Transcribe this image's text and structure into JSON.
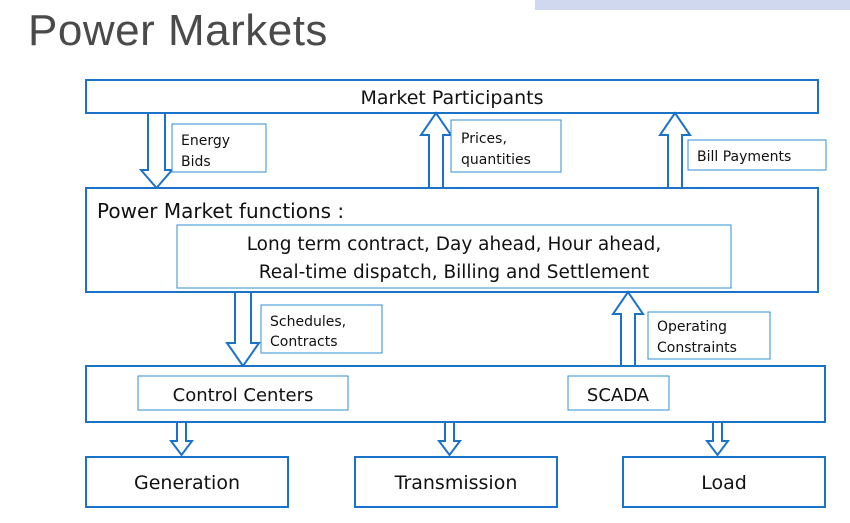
{
  "title": "Power Markets",
  "market_participants": "Market Participants",
  "labels": {
    "energy_bids": [
      "Energy",
      "Bids"
    ],
    "prices_quantities": [
      "Prices,",
      "quantities"
    ],
    "bill_payments": "Bill Payments",
    "schedules_contracts": [
      "Schedules,",
      "Contracts"
    ],
    "operating_constraints": [
      "Operating",
      "Constraints"
    ]
  },
  "functions": {
    "heading": "Power Market functions :",
    "line1": "Long term contract, Day ahead, Hour ahead,",
    "line2": "Real-time dispatch, Billing and Settlement"
  },
  "control_centers": "Control Centers",
  "scada": "SCADA",
  "outputs": {
    "generation": "Generation",
    "transmission": "Transmission",
    "load": "Load"
  },
  "colors": {
    "box_stroke": "#1a73c9",
    "label_stroke": "#2f8fd3",
    "title_text": "#4a4a4a",
    "top_strip": "#cfd8ef"
  }
}
